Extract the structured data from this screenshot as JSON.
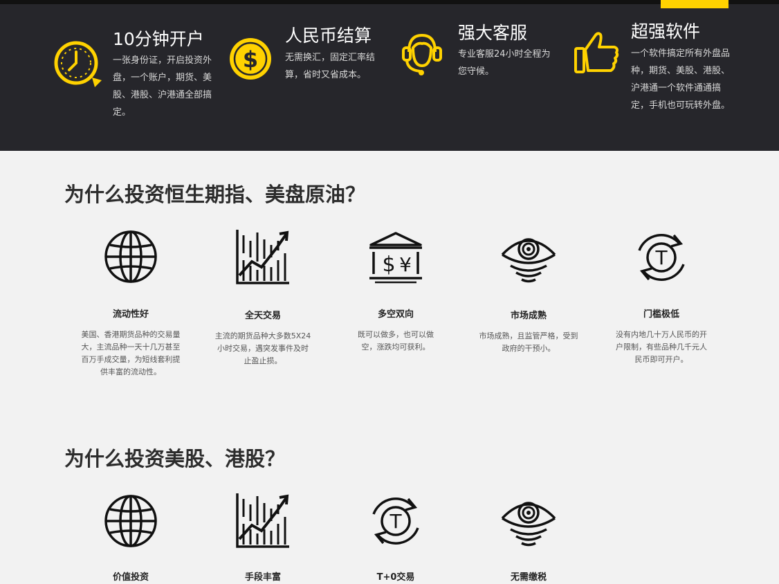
{
  "colors": {
    "header_bg": "#26262b",
    "accent": "#ffd200",
    "page_bg": "#f2f2f2"
  },
  "features": [
    {
      "icon": "clock-icon",
      "title": "10分钟开户",
      "desc": "一张身份证，开启投资外盘，一个账户，期货、美股、港股、沪港通全部搞定。"
    },
    {
      "icon": "dollar-coin-icon",
      "title": "人民币结算",
      "desc": "无需换汇，固定汇率结算，省时又省成本。"
    },
    {
      "icon": "headset-agent-icon",
      "title": "强大客服",
      "desc": "专业客服24小时全程为您守候。"
    },
    {
      "icon": "thumbs-up-icon",
      "title": "超强软件",
      "desc": "一个软件搞定所有外盘品种，期货、美股、港股、沪港通一个软件通通搞定，手机也可玩转外盘。"
    }
  ],
  "section1": {
    "title": "为什么投资恒生期指、美盘原油？",
    "items": [
      {
        "icon": "globe-icon",
        "title": "流动性好",
        "desc": "美国、香港期货品种的交易量大，主流品种一天十几万甚至百万手成交量，为短线套利提供丰富的流动性。"
      },
      {
        "icon": "chart-growth-icon",
        "title": "全天交易",
        "desc": "主流的期货品种大多数5X24小时交易，遇突发事件及时止盈止损。"
      },
      {
        "icon": "currency-exchange-icon",
        "title": "多空双向",
        "desc": "既可以做多，也可以做空，涨跌均可获利。"
      },
      {
        "icon": "eye-icon",
        "title": "市场成熟",
        "desc": "市场成熟，且监管严格，受到政府的干预小。"
      },
      {
        "icon": "t-plus-zero-icon",
        "title": "门槛极低",
        "desc": "没有内地几十万人民币的开户限制，有些品种几千元人民币即可开户。"
      }
    ]
  },
  "section2": {
    "title": "为什么投资美股、港股？",
    "items": [
      {
        "icon": "globe-icon",
        "title": "价值投资"
      },
      {
        "icon": "chart-growth-icon",
        "title": "手段丰富"
      },
      {
        "icon": "t-plus-zero-icon",
        "title": "T+0交易"
      },
      {
        "icon": "eye-icon",
        "title": "无需缴税"
      }
    ]
  }
}
